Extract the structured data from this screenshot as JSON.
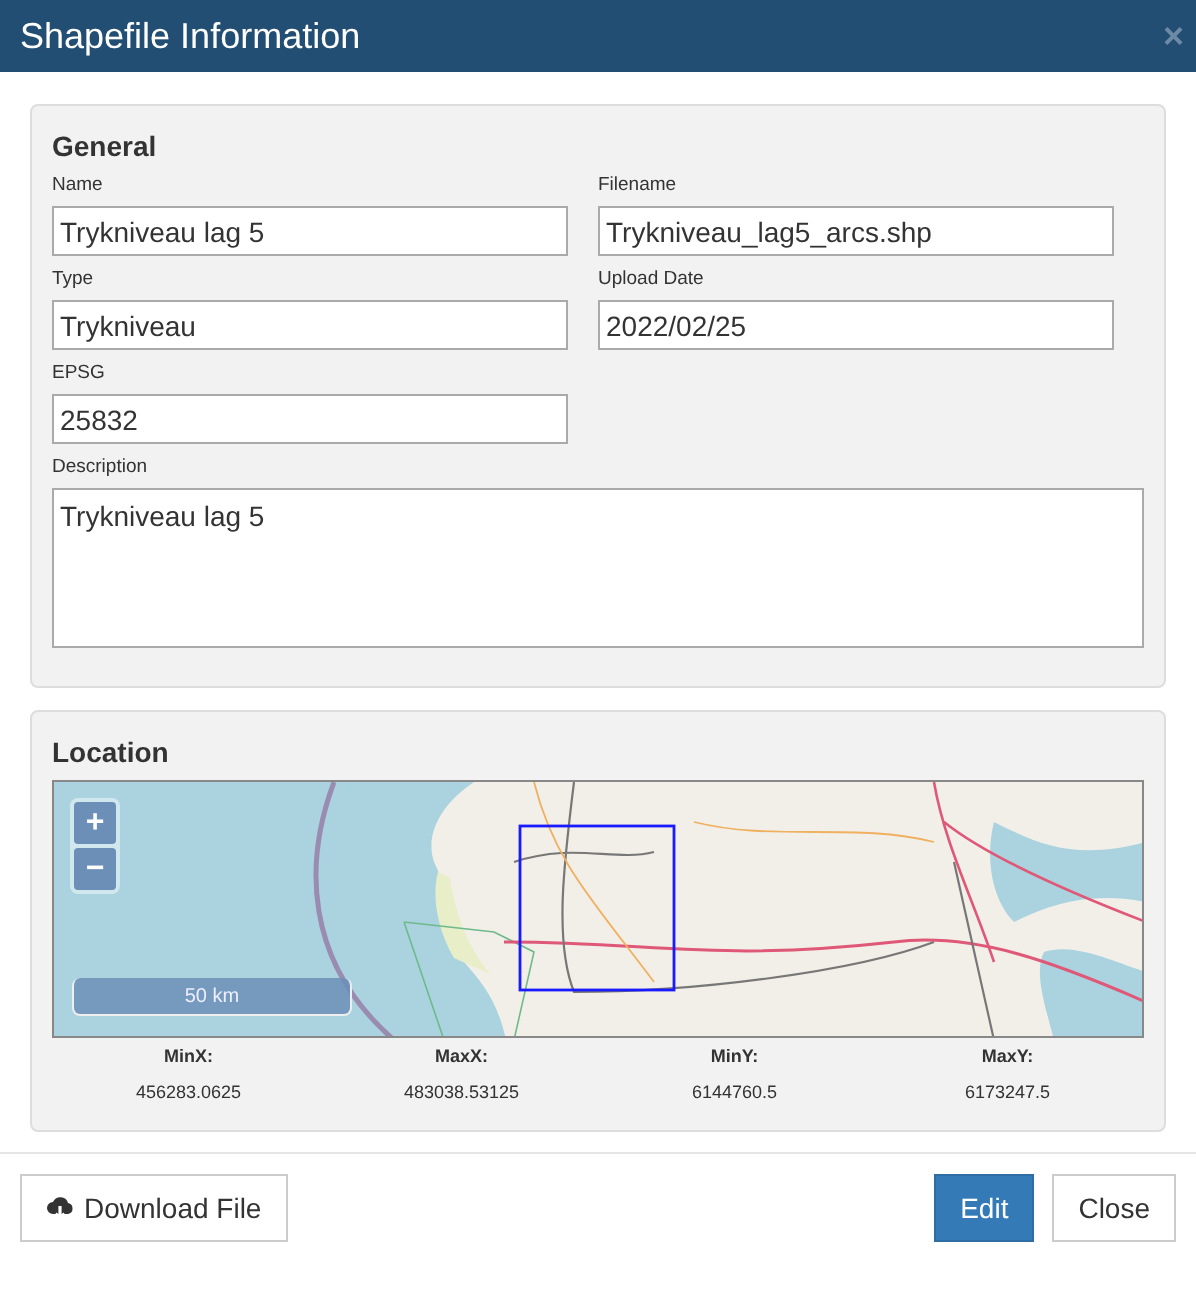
{
  "window": {
    "title": "Shapefile Information",
    "close": "×"
  },
  "general": {
    "heading": "General",
    "fields": [
      {
        "label": "Name",
        "value": "Trykniveau lag 5"
      },
      {
        "label": "Filename",
        "value": "Trykniveau_lag5_arcs.shp"
      },
      {
        "label": "Type",
        "value": "Trykniveau"
      },
      {
        "label": "Upload Date",
        "value": "2022/02/25"
      },
      {
        "label": "EPSG",
        "value": "25832"
      }
    ],
    "description": {
      "label": "Description",
      "value": "Trykniveau lag 5"
    }
  },
  "location": {
    "heading": "Location",
    "map": {
      "zoom_in": "+",
      "zoom_out": "−",
      "scale": "50 km"
    },
    "bounds": [
      {
        "label": "MinX:",
        "value": "456283.0625"
      },
      {
        "label": "MaxX:",
        "value": "483038.53125"
      },
      {
        "label": "MinY:",
        "value": "6144760.5"
      },
      {
        "label": "MaxY:",
        "value": "6173247.5"
      }
    ]
  },
  "buttons": [
    {
      "label": "Download File",
      "kind": "download"
    },
    {
      "label": "Edit",
      "kind": "primary"
    },
    {
      "label": "Close",
      "kind": "default"
    }
  ]
}
